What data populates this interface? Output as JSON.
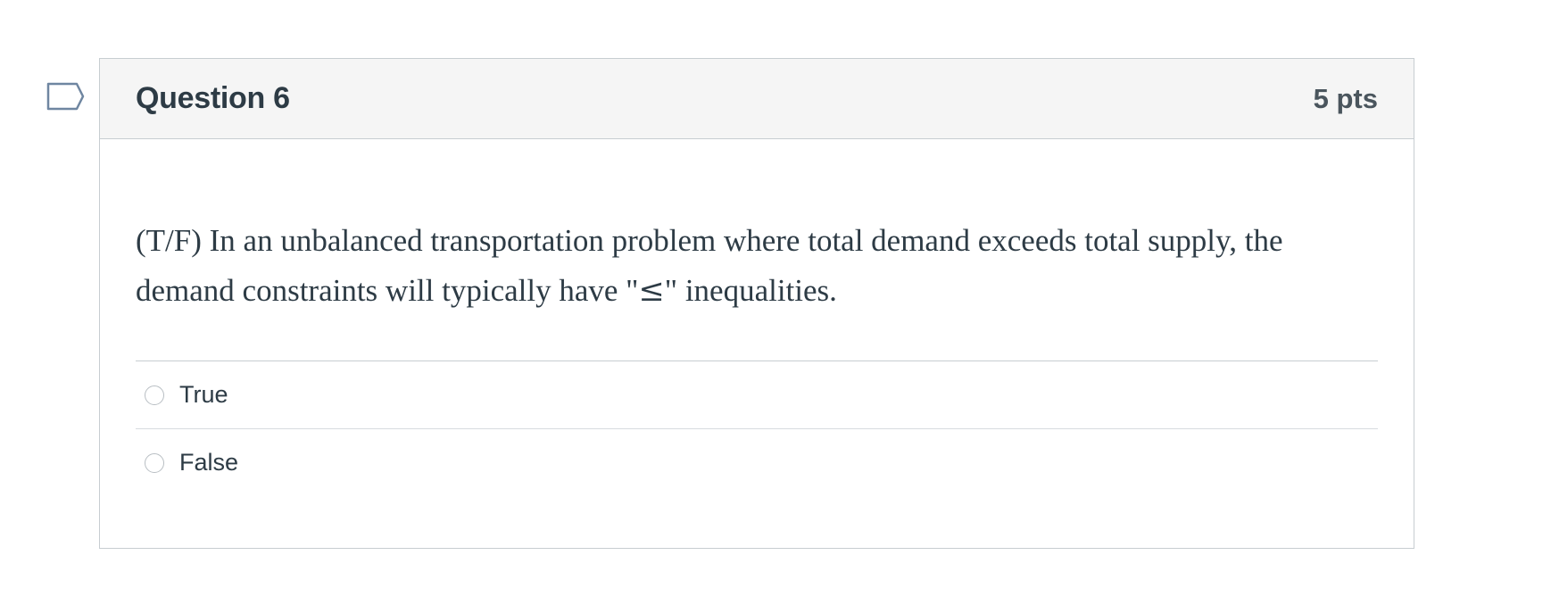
{
  "question": {
    "title": "Question 6",
    "points": "5 pts",
    "text_before": "(T/F) In an unbalanced transportation problem where total demand exceeds total supply, the demand constraints will typically have \"",
    "symbol": "≤",
    "text_after": "\" inequalities.",
    "flag_icon": "flag-question-icon",
    "answers": [
      {
        "label": "True",
        "selected": false
      },
      {
        "label": "False",
        "selected": false
      }
    ]
  },
  "colors": {
    "header_bg": "#f5f5f5",
    "border": "#c7cdd1",
    "text": "#2d3b45",
    "flag_outline": "#6f86a1"
  }
}
